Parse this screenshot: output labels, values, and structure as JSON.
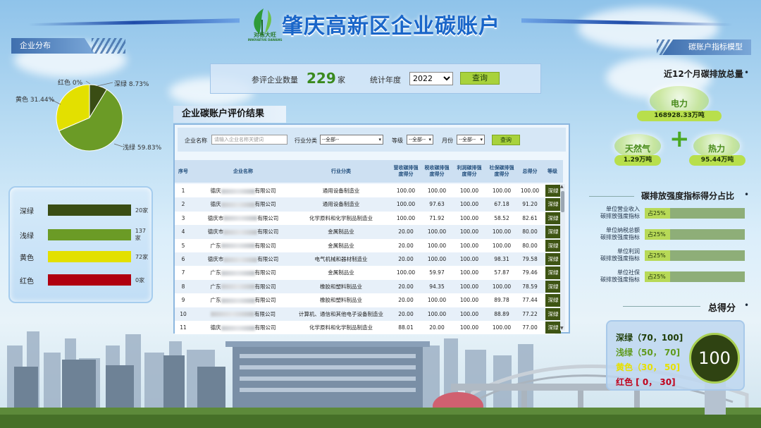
{
  "header": {
    "title": "肇庆高新区企业碳账户",
    "logo_text": "对标大旺",
    "logo_subtext": "INNOVATIVE DAWANG"
  },
  "left": {
    "section_tab": "企业分布",
    "pie": {
      "labels": [
        {
          "text": "深绿 8.73%"
        },
        {
          "text": "红色 0%"
        },
        {
          "text": "黄色 31.44%"
        },
        {
          "text": "浅绿 59.83%"
        }
      ]
    },
    "legend": [
      {
        "name": "深绿",
        "count": "20家",
        "color": "#3a4d14"
      },
      {
        "name": "浅绿",
        "count": "137家",
        "color": "#6b9b26"
      },
      {
        "name": "黄色",
        "count": "72家",
        "color": "#e3e000"
      },
      {
        "name": "红色",
        "count": "0家",
        "color": "#b00010"
      }
    ]
  },
  "stats": {
    "count_label": "参评企业数量",
    "count_value": "229",
    "count_unit": "家",
    "year_label": "统计年度",
    "year_value": "2022",
    "query_label": "查询"
  },
  "table_panel": {
    "title": "企业碳账户评价结果",
    "filters": {
      "name_label": "企业名称",
      "name_placeholder": "请输入企业名称关键词",
      "industry_label": "行业分类",
      "industry_value": "--全部--",
      "level_label": "等级",
      "level_value": "--全部--",
      "month_label": "月份",
      "month_value": "--全部--",
      "query_label": "查询"
    },
    "headers": {
      "seq": "序号",
      "name": "企业名称",
      "industry": "行业分类",
      "revenue": "营收碳排强度得分",
      "tax": "税收碳排强度得分",
      "profit": "利润碳排强度得分",
      "social": "社保碳排强度得分",
      "total": "总得分",
      "level": "等级"
    },
    "rows": [
      {
        "seq": "1",
        "name_pre": "德庆",
        "name_suf": "有限公司",
        "industry": "通用设备制造业",
        "revenue": "100.00",
        "tax": "100.00",
        "profit": "100.00",
        "social": "100.00",
        "total": "100.00",
        "level": "深绿"
      },
      {
        "seq": "2",
        "name_pre": "德庆",
        "name_suf": "有限公司",
        "industry": "通用设备制造业",
        "revenue": "100.00",
        "tax": "97.63",
        "profit": "100.00",
        "social": "67.18",
        "total": "91.20",
        "level": "深绿"
      },
      {
        "seq": "3",
        "name_pre": "德庆市",
        "name_suf": "有限公司",
        "industry": "化学原料和化学制品制造业",
        "revenue": "100.00",
        "tax": "71.92",
        "profit": "100.00",
        "social": "58.52",
        "total": "82.61",
        "level": "深绿"
      },
      {
        "seq": "4",
        "name_pre": "德庆市",
        "name_suf": "有限公司",
        "industry": "金属制品业",
        "revenue": "20.00",
        "tax": "100.00",
        "profit": "100.00",
        "social": "100.00",
        "total": "80.00",
        "level": "深绿"
      },
      {
        "seq": "5",
        "name_pre": "广东",
        "name_suf": "有限公司",
        "industry": "金属制品业",
        "revenue": "20.00",
        "tax": "100.00",
        "profit": "100.00",
        "social": "100.00",
        "total": "80.00",
        "level": "深绿"
      },
      {
        "seq": "6",
        "name_pre": "德庆市",
        "name_suf": "有限公司",
        "industry": "电气机械和器材制造业",
        "revenue": "20.00",
        "tax": "100.00",
        "profit": "100.00",
        "social": "98.31",
        "total": "79.58",
        "level": "深绿"
      },
      {
        "seq": "7",
        "name_pre": "广东",
        "name_suf": "有限公司",
        "industry": "金属制品业",
        "revenue": "100.00",
        "tax": "59.97",
        "profit": "100.00",
        "social": "57.87",
        "total": "79.46",
        "level": "深绿"
      },
      {
        "seq": "8",
        "name_pre": "广东",
        "name_suf": "有限公司",
        "industry": "橡胶和塑料制品业",
        "revenue": "20.00",
        "tax": "94.35",
        "profit": "100.00",
        "social": "100.00",
        "total": "78.59",
        "level": "深绿"
      },
      {
        "seq": "9",
        "name_pre": "广东",
        "name_suf": "有限公司",
        "industry": "橡胶和塑料制品业",
        "revenue": "20.00",
        "tax": "100.00",
        "profit": "100.00",
        "social": "89.78",
        "total": "77.44",
        "level": "深绿"
      },
      {
        "seq": "10",
        "name_pre": "",
        "name_suf": "有限公司",
        "industry": "计算机、通信和其他电子设备制造业",
        "revenue": "20.00",
        "tax": "100.00",
        "profit": "100.00",
        "social": "88.89",
        "total": "77.22",
        "level": "深绿"
      },
      {
        "seq": "11",
        "name_pre": "德庆",
        "name_suf": "有限公司",
        "industry": "化学原料和化学制品制造业",
        "revenue": "88.01",
        "tax": "20.00",
        "profit": "100.00",
        "social": "100.00",
        "total": "77.00",
        "level": "深绿"
      }
    ]
  },
  "right": {
    "section_tab": "碳账户指标模型",
    "emission_title": "近12个月碳排放总量",
    "electricity": {
      "name": "电力",
      "value": "168928.33万吨"
    },
    "gas": {
      "name": "天然气",
      "value": "1.29万吨"
    },
    "heat": {
      "name": "热力",
      "value": "95.44万吨"
    },
    "plus": "+",
    "share_title": "碳排放强度指标得分占比",
    "indicators": [
      {
        "line1": "单位营业收入",
        "line2": "碳排放强度指标",
        "value": "占25%",
        "fraction": 0.25
      },
      {
        "line1": "单位纳税总额",
        "line2": "碳排放强度指标",
        "value": "占25%",
        "fraction": 0.25
      },
      {
        "line1": "单位利润",
        "line2": "碳排放强度指标",
        "value": "占25%",
        "fraction": 0.25
      },
      {
        "line1": "单位社保",
        "line2": "碳排放强度指标",
        "value": "占25%",
        "fraction": 0.25
      }
    ],
    "total_title": "总得分",
    "score_ranges": [
      {
        "text": "深绿（70，100]",
        "color": "#1e3c06"
      },
      {
        "text": "浅绿（50，  70]",
        "color": "#5f9a1c"
      },
      {
        "text": "黄色（30，  50]",
        "color": "#e6e000"
      },
      {
        "text": "红色 [  0，  30]",
        "color": "#c0001a"
      }
    ],
    "total_score": "100"
  },
  "chart_data": {
    "type": "pie",
    "categories": [
      "深绿",
      "浅绿",
      "黄色",
      "红色"
    ],
    "values": [
      8.73,
      59.83,
      31.44,
      0
    ],
    "colors": [
      "#3a4d14",
      "#6b9b26",
      "#e3e000",
      "#b00010"
    ]
  }
}
